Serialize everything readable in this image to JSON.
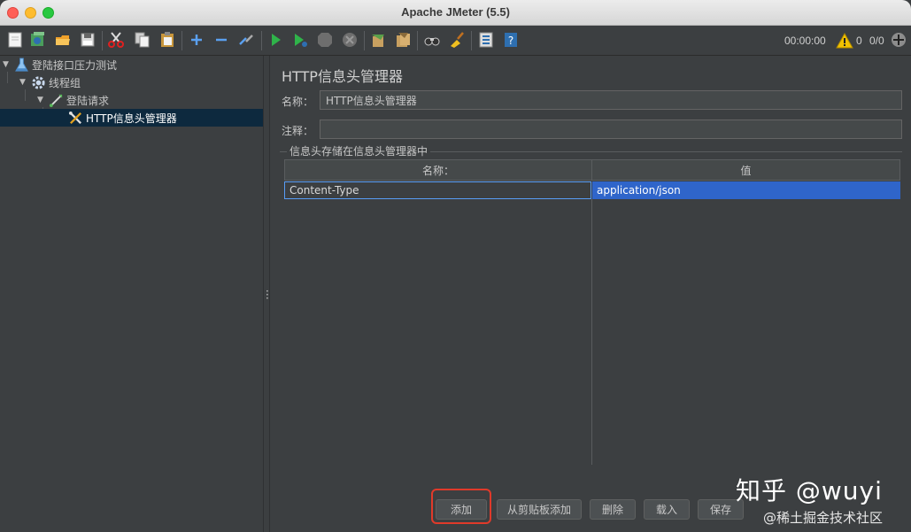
{
  "window": {
    "title": "Apache JMeter (5.5)"
  },
  "toolbar": {
    "icons": [
      "new-icon",
      "templates-icon",
      "open-icon",
      "save-icon",
      "cut-icon",
      "copy-icon",
      "paste-icon",
      "expand-icon",
      "collapse-icon",
      "toggle-icon",
      "start-icon",
      "start-no-pause-icon",
      "stop-icon",
      "shutdown-icon",
      "clear-icon",
      "clear-all-icon",
      "search-icon",
      "reset-search-icon",
      "function-helper-icon",
      "help-icon"
    ],
    "timer": "00:00:00",
    "warning_count": "0",
    "thread_count": "0/0"
  },
  "tree": {
    "items": [
      {
        "label": "登陆接口压力测试",
        "icon": "test-plan-icon",
        "level": 0
      },
      {
        "label": "线程组",
        "icon": "thread-group-icon",
        "level": 1
      },
      {
        "label": "登陆请求",
        "icon": "sampler-icon",
        "level": 2
      },
      {
        "label": "HTTP信息头管理器",
        "icon": "config-element-icon",
        "level": 3,
        "selected": true
      }
    ]
  },
  "panel": {
    "title": "HTTP信息头管理器",
    "name_label": "名称：",
    "name_value": "HTTP信息头管理器",
    "comment_label": "注释：",
    "comment_value": "",
    "group_title": "信息头存储在信息头管理器中",
    "table": {
      "columns": [
        "名称：",
        "值"
      ],
      "rows": [
        [
          "Content-Type",
          "application/json"
        ]
      ]
    },
    "buttons": {
      "add": "添加",
      "add_from_clipboard": "从剪贴板添加",
      "delete": "删除",
      "load": "载入",
      "save": "保存"
    }
  },
  "watermark": {
    "line1": "知乎 @wuyi",
    "line2": "@稀土掘金技术社区"
  },
  "colors": {
    "background": "#3c3f41",
    "selection": "#2f65ca",
    "tree_selection": "#0d293e",
    "highlight": "#e03a2a"
  }
}
